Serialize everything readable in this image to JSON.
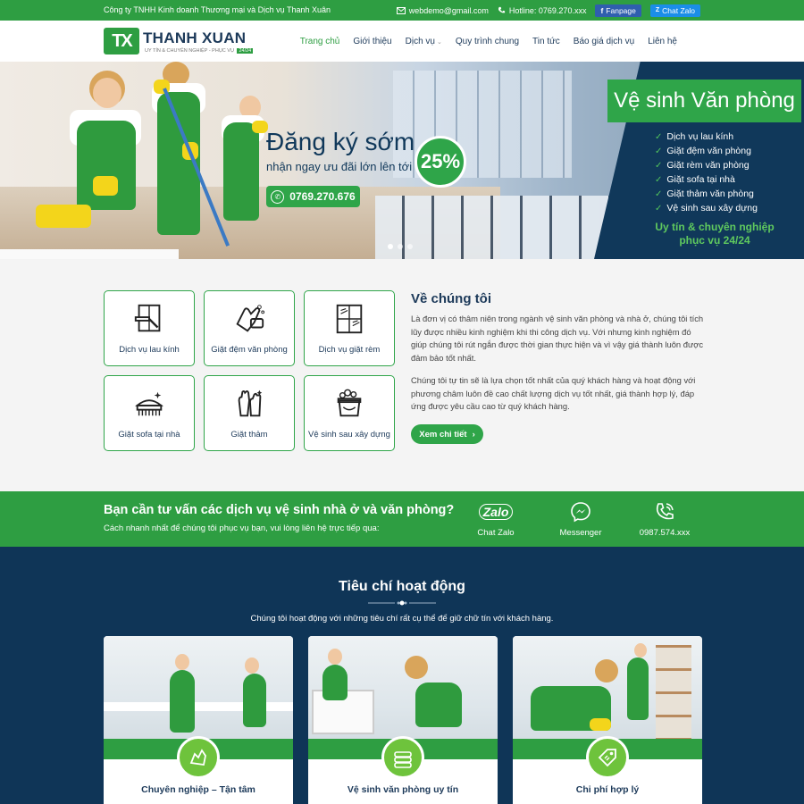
{
  "topbar": {
    "company": "Công ty TNHH Kinh doanh Thương mại và Dịch vụ Thanh Xuân",
    "email": "webdemo@gmail.com",
    "hotline": "Hotline: 0769.270.xxx",
    "fanpage": "Fanpage",
    "chat_zalo": "Chat Zalo"
  },
  "logo": {
    "mark": "TX",
    "name": "THANH XUAN",
    "sub": "UY TÍN & CHUYÊN NGHIỆP - PHỤC VỤ",
    "sub_badge": "24/24"
  },
  "nav": {
    "items": [
      {
        "label": "Trang chủ",
        "active": true
      },
      {
        "label": "Giới thiệu"
      },
      {
        "label": "Dịch vụ",
        "has_caret": true
      },
      {
        "label": "Quy trình chung"
      },
      {
        "label": "Tin tức"
      },
      {
        "label": "Báo giá dịch vụ"
      },
      {
        "label": "Liên hệ"
      }
    ]
  },
  "hero": {
    "promo_line1": "Đăng ký sớm",
    "promo_line2": "nhận ngay ưu đãi lớn lên tới",
    "discount": "25%",
    "phone": "0769.270.676",
    "title": "Vệ sinh Văn phòng",
    "services": [
      "Dịch vụ lau kính",
      "Giặt đệm văn phòng",
      "Giặt rèm văn phòng",
      "Giặt sofa tại nhà",
      "Giặt thảm văn phòng",
      "Vệ sinh sau xây dựng"
    ],
    "tagline_1": "Uy tín & chuyên nghiệp",
    "tagline_2": "phục vụ 24/24",
    "slides": 3,
    "active_slide": 1
  },
  "services": [
    {
      "label": "Dịch vụ lau kính",
      "icon": "window-squeegee-icon"
    },
    {
      "label": "Giặt đệm văn phòng",
      "icon": "glove-sponge-icon"
    },
    {
      "label": "Dịch vụ giặt rèm",
      "icon": "curtain-window-icon"
    },
    {
      "label": "Giặt sofa tại nhà",
      "icon": "brush-icon"
    },
    {
      "label": "Giặt thảm",
      "icon": "gloves-icon"
    },
    {
      "label": "Vệ sinh sau xây dựng",
      "icon": "bucket-icon"
    }
  ],
  "about": {
    "title": "Về chúng tôi",
    "paragraph_1": "Là đơn vị có thâm niên trong ngành vệ sinh văn phòng và nhà ở, chúng tôi tích lũy được nhiều kinh nghiệm khi thi công dịch vụ. Với nhưng kinh nghiệm đó giúp chúng tôi rút ngắn được thời gian thực hiện và vì vậy giá thành luôn được đảm bảo tốt nhất.",
    "paragraph_2": "Chúng tôi tự tin sẽ là lựa chọn tốt nhất của quý khách hàng và hoạt động với phương châm luôn đề cao chất lượng dịch vụ tốt nhất, giá thành hợp lý, đáp ứng được yêu cầu cao từ quý khách hàng.",
    "button": "Xem chi tiết"
  },
  "consult": {
    "title": "Bạn cần tư vấn các dịch vụ vệ sinh nhà ở và văn phòng?",
    "subtitle": "Cách nhanh nhất để chúng tôi phục vụ bạn, vui lòng liên hệ trực tiếp qua:",
    "zalo_logo": "Zalo",
    "chat_zalo": "Chat Zalo",
    "messenger": "Messenger",
    "phone": "0987.574.xxx"
  },
  "criteria": {
    "title": "Tiêu chí hoạt động",
    "subtitle": "Chúng tôi hoạt động với những tiêu chí rất cụ thể để giữ chữ tín với khách hàng.",
    "cards": [
      {
        "label": "Chuyên nghiệp – Tận tâm",
        "icon": "cleaning-hands-icon"
      },
      {
        "label": "Vệ sinh văn phòng uy tín",
        "icon": "stack-towels-icon"
      },
      {
        "label": "Chi phí hợp lý",
        "icon": "price-tag-icon"
      }
    ]
  },
  "colors": {
    "green": "#2e9e42",
    "navy": "#0f3557",
    "badge_green": "#6ec33c"
  }
}
